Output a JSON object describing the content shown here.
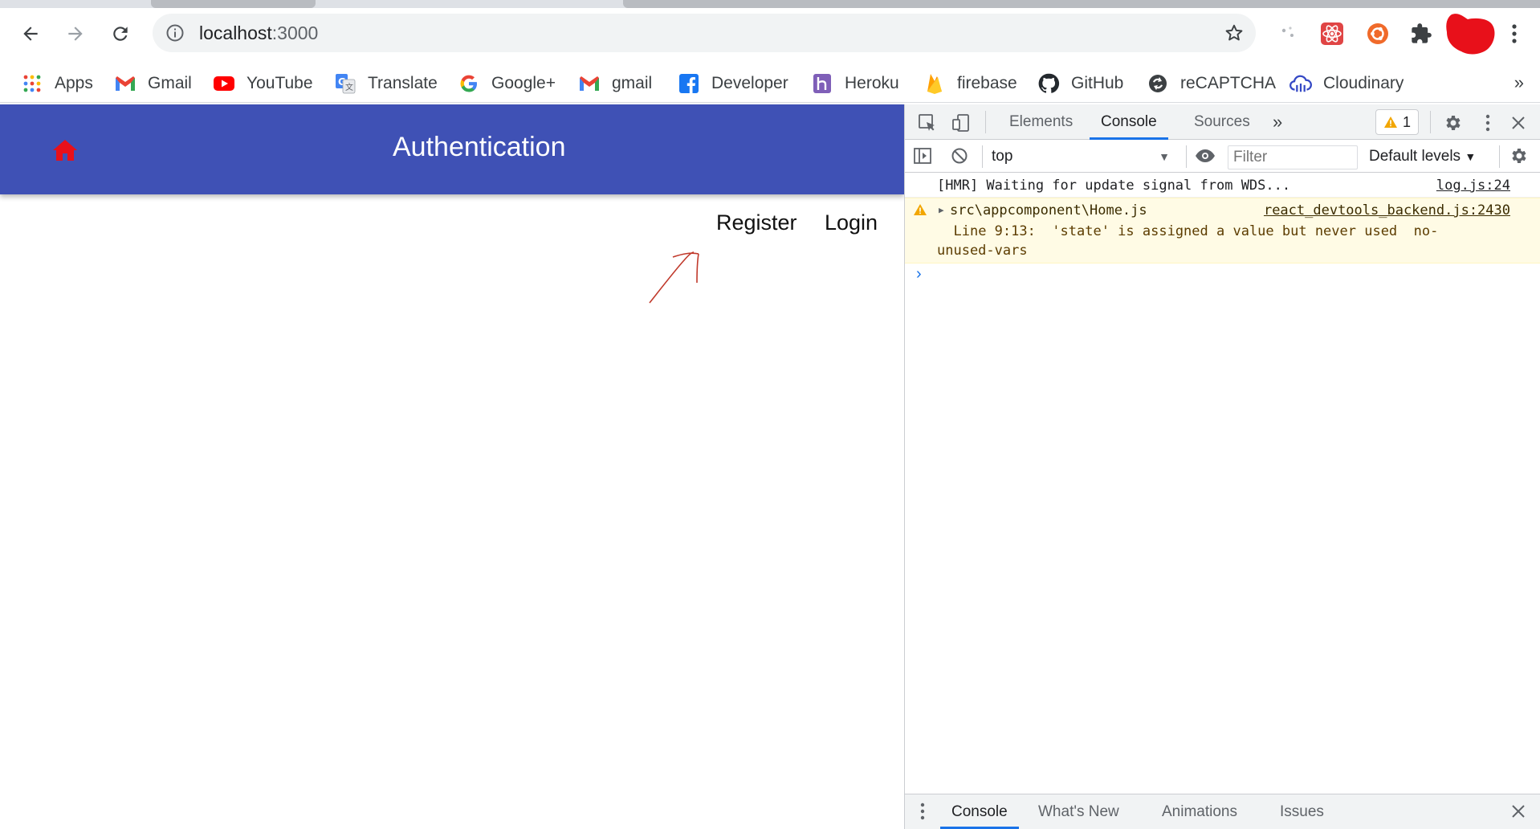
{
  "browser": {
    "url_host": "localhost",
    "url_port": ":3000",
    "bookmarks": [
      {
        "label": "Apps",
        "icon": "apps-grid-icon"
      },
      {
        "label": "Gmail",
        "icon": "gmail-icon"
      },
      {
        "label": "YouTube",
        "icon": "youtube-icon"
      },
      {
        "label": "Translate",
        "icon": "translate-icon"
      },
      {
        "label": "Google+",
        "icon": "google-icon"
      },
      {
        "label": "gmail",
        "icon": "gmail-icon"
      },
      {
        "label": "Developer",
        "icon": "facebook-icon"
      },
      {
        "label": "Heroku",
        "icon": "heroku-icon"
      },
      {
        "label": "firebase",
        "icon": "firebase-icon"
      },
      {
        "label": "GitHub",
        "icon": "github-icon"
      },
      {
        "label": "reCAPTCHA",
        "icon": "recaptcha-icon"
      },
      {
        "label": "Cloudinary",
        "icon": "cloudinary-icon"
      }
    ],
    "more_bookmarks": "»"
  },
  "app": {
    "title": "Authentication",
    "nav": {
      "register": "Register",
      "login": "Login"
    },
    "appbar_color": "#3f51b5",
    "home_icon_color": "#e8101a"
  },
  "devtools": {
    "tabs": [
      "Elements",
      "Console",
      "Sources"
    ],
    "active_tab": "Console",
    "more_tabs": "»",
    "warning_count": "1",
    "context": "top",
    "filter_placeholder": "Filter",
    "levels": "Default levels",
    "logs": [
      {
        "message": "[HMR] Waiting for update signal from WDS...",
        "source": "log.js:24"
      }
    ],
    "warning": {
      "file": "src\\appcomponent\\Home.js",
      "source": "react_devtools_backend.js:2430",
      "body": "  Line 9:13:  'state' is assigned a value but never used  no-\nunused-vars"
    },
    "prompt": "›",
    "drawer_tabs": [
      "Console",
      "What's New",
      "Animations",
      "Issues"
    ]
  }
}
